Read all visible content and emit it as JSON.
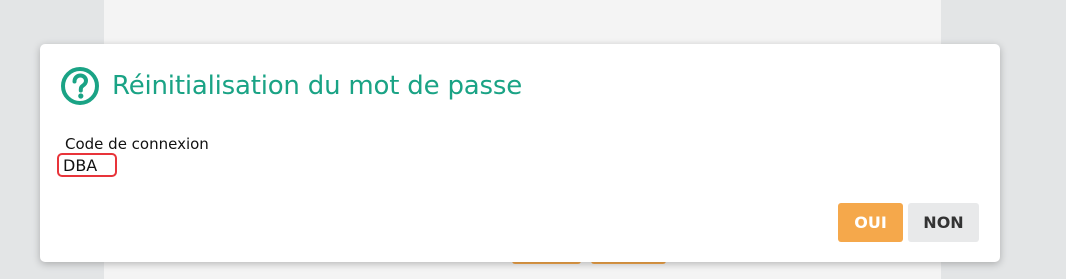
{
  "dialog": {
    "title": "Réinitialisation du mot de passe",
    "icon": "help-circle-icon",
    "field_label": "Code de connexion",
    "field_value": "DBA",
    "yes_label": "OUI",
    "no_label": "NON"
  },
  "colors": {
    "title": "#1aa385",
    "yes_button": "#f5a84b",
    "no_button": "#e8e9ea",
    "input_border": "#e8343a"
  }
}
